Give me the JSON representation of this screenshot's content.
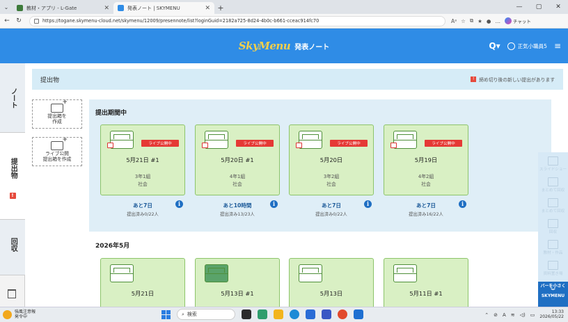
{
  "browser": {
    "tabs": [
      {
        "title": "教材・アプリ - L-Gate",
        "active": false
      },
      {
        "title": "発表ノート | SKYMENU",
        "active": true
      }
    ],
    "new_tab": "+",
    "window_controls": [
      "—",
      "▢",
      "✕"
    ],
    "url": "https://togane.skymenu-cloud.net/skymenu/12009/presennote/list?loginGuid=2182a725-8d24-4b0c-b661-cceac914fc70",
    "chat_label": "チャット"
  },
  "app": {
    "logo": "SkyMenu",
    "title": "発表ノート",
    "user": "正気小職員5",
    "accent": "#2f8ce6"
  },
  "sidebar": {
    "note": "ノート",
    "submissions": "提出物",
    "collect": "回収",
    "alert": "!"
  },
  "subbar": {
    "title": "提出物",
    "notice": "締め切り後の新しい提出があります",
    "notice_icon": "!"
  },
  "create": {
    "box": "提出箱を\n作成",
    "live_box": "ライブ公開\n提出箱を作成"
  },
  "active_section": {
    "title": "提出期間中",
    "cards": [
      {
        "date": "5月21日 #1",
        "class": "3年1組",
        "subject": "社会",
        "live": "ライブ公開中",
        "remaining": "あと7日",
        "count": "提出済み0/22人"
      },
      {
        "date": "5月20日 #1",
        "class": "4年1組",
        "subject": "社会",
        "live": "ライブ公開中",
        "remaining": "あと10時間",
        "count": "提出済み13/23人"
      },
      {
        "date": "5月20日",
        "class": "3年2組",
        "subject": "社会",
        "live": "ライブ公開中",
        "remaining": "あと7日",
        "count": "提出済み0/22人"
      },
      {
        "date": "5月19日",
        "class": "4年2組",
        "subject": "社会",
        "live": "ライブ公開中",
        "remaining": "あと7日",
        "count": "提出済み16/22人"
      }
    ]
  },
  "month_section": {
    "title": "2026年5月",
    "cards": [
      {
        "date": "5月21日",
        "green": false
      },
      {
        "date": "5月13日 #1",
        "green": true
      },
      {
        "date": "5月13日",
        "green": false
      },
      {
        "date": "5月11日 #1",
        "green": false
      }
    ]
  },
  "right_toolbar": {
    "items": [
      "スライドショー",
      "まとめて回収",
      "まとめて回収",
      "回収",
      "教材・作品",
      "資料置き場"
    ],
    "bottom": "バーを小さく",
    "brand": "SKYMENU"
  },
  "taskbar": {
    "weather_title": "強風注意報",
    "weather_sub": "発令中",
    "search": "検索",
    "time": "13:33",
    "date": "2026/05/22"
  }
}
